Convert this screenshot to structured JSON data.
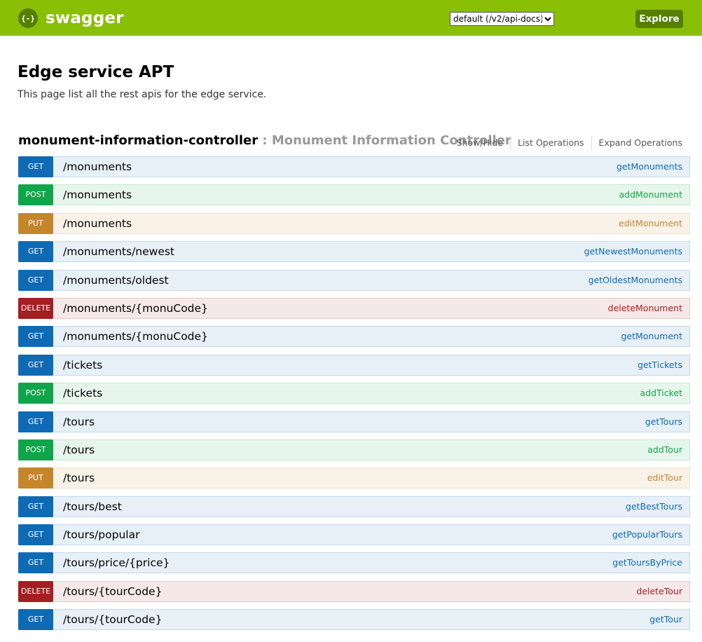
{
  "header": {
    "logo_icon": "{-}",
    "logo_text": "swagger",
    "spec_selected": "default (/v2/api-docs)",
    "explore_label": "Explore",
    "brand_color": "#89bf04",
    "accent_color": "#547f00"
  },
  "info": {
    "title": "Edge service APT",
    "description": "This page list all the rest apis for the edge service."
  },
  "resource": {
    "name": "monument-information-controller",
    "separator": " : ",
    "description": "Monument Information Controller",
    "ops_links": [
      "Show/Hide",
      "List Operations",
      "Expand Operations"
    ]
  },
  "operations": [
    {
      "method": "GET",
      "path": "/monuments",
      "nickname": "getMonuments"
    },
    {
      "method": "POST",
      "path": "/monuments",
      "nickname": "addMonument"
    },
    {
      "method": "PUT",
      "path": "/monuments",
      "nickname": "editMonument"
    },
    {
      "method": "GET",
      "path": "/monuments/newest",
      "nickname": "getNewestMonuments"
    },
    {
      "method": "GET",
      "path": "/monuments/oldest",
      "nickname": "getOldestMonuments"
    },
    {
      "method": "DELETE",
      "path": "/monuments/{monuCode}",
      "nickname": "deleteMonument"
    },
    {
      "method": "GET",
      "path": "/monuments/{monuCode}",
      "nickname": "getMonument"
    },
    {
      "method": "GET",
      "path": "/tickets",
      "nickname": "getTickets"
    },
    {
      "method": "POST",
      "path": "/tickets",
      "nickname": "addTicket"
    },
    {
      "method": "GET",
      "path": "/tours",
      "nickname": "getTours"
    },
    {
      "method": "POST",
      "path": "/tours",
      "nickname": "addTour"
    },
    {
      "method": "PUT",
      "path": "/tours",
      "nickname": "editTour"
    },
    {
      "method": "GET",
      "path": "/tours/best",
      "nickname": "getBestTours"
    },
    {
      "method": "GET",
      "path": "/tours/popular",
      "nickname": "getPopularTours"
    },
    {
      "method": "GET",
      "path": "/tours/price/{price}",
      "nickname": "getToursByPrice"
    },
    {
      "method": "DELETE",
      "path": "/tours/{tourCode}",
      "nickname": "deleteTour"
    },
    {
      "method": "GET",
      "path": "/tours/{tourCode}",
      "nickname": "getTour"
    }
  ],
  "method_colors": {
    "GET": "#0f6ab4",
    "POST": "#10a54a",
    "PUT": "#c5862b",
    "DELETE": "#a41e22"
  }
}
